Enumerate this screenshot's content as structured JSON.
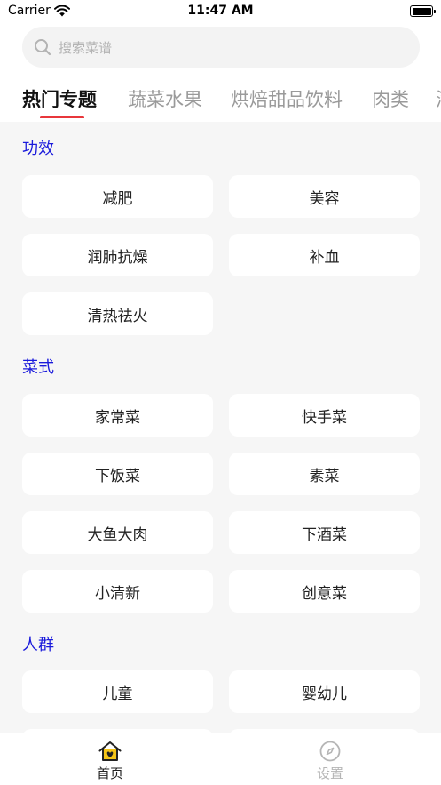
{
  "status_bar": {
    "carrier": "Carrier",
    "time": "11:47 AM"
  },
  "search": {
    "placeholder": "搜索菜谱",
    "icon": "search-icon"
  },
  "tabs": [
    {
      "label": "热门专题",
      "active": true
    },
    {
      "label": "蔬菜水果",
      "active": false
    },
    {
      "label": "烘焙甜品饮料",
      "active": false
    },
    {
      "label": "肉类",
      "active": false
    },
    {
      "label": "海",
      "active": false
    }
  ],
  "colors": {
    "accent": "#e8363b",
    "section_title": "#1a1adb",
    "background": "#f6f6f6"
  },
  "sections": [
    {
      "title": "功效",
      "items": [
        "减肥",
        "美容",
        "润肺抗燥",
        "补血",
        "清热祛火"
      ]
    },
    {
      "title": "菜式",
      "items": [
        "家常菜",
        "快手菜",
        "下饭菜",
        "素菜",
        "大鱼大肉",
        "下酒菜",
        "小清新",
        "创意菜"
      ]
    },
    {
      "title": "人群",
      "items": [
        "儿童",
        "婴幼儿"
      ]
    }
  ],
  "tab_bar": [
    {
      "label": "首页",
      "icon": "home-icon",
      "active": true
    },
    {
      "label": "设置",
      "icon": "compass-icon",
      "active": false
    }
  ]
}
